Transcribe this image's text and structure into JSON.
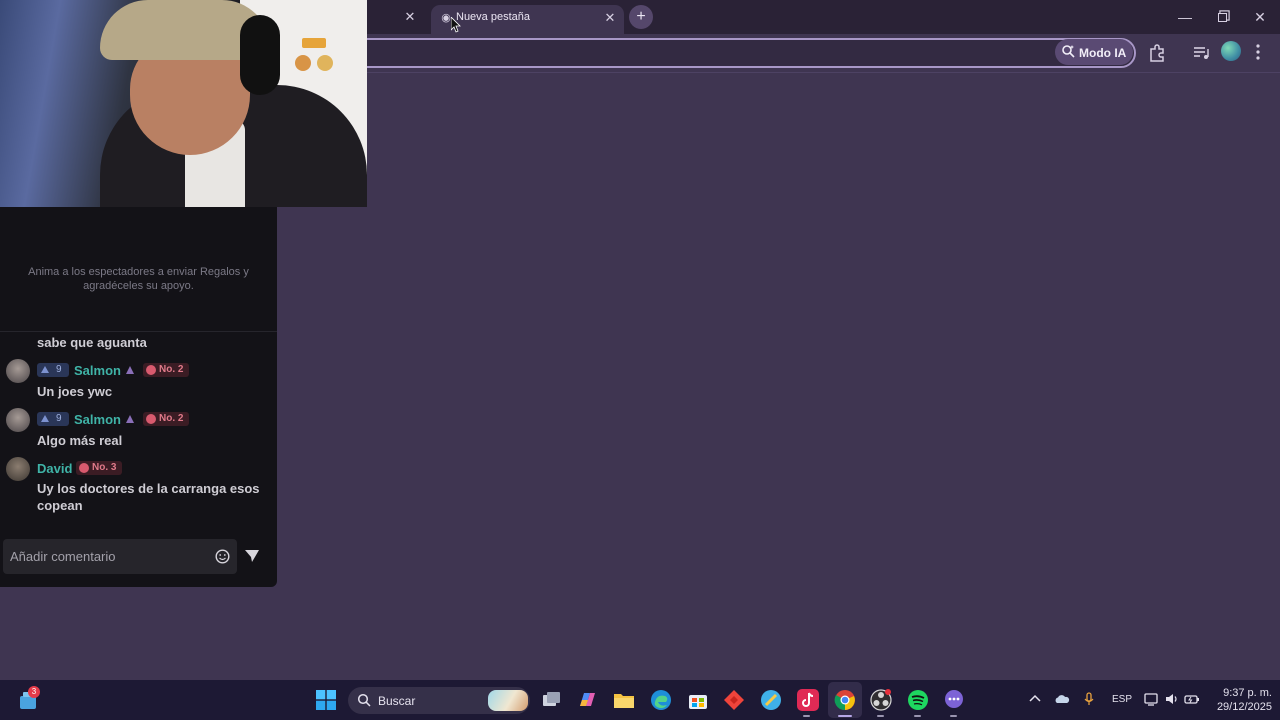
{
  "browser": {
    "active_tab_title": "Nueva pestaña",
    "ai_mode_label": "Modo IA"
  },
  "chat": {
    "gift_prompt": "Anima a los espectadores a enviar Regalos y agradéceles su apoyo.",
    "partial_message": "sabe que aguanta",
    "messages": [
      {
        "level": "9",
        "user": "Salmon",
        "rank": "No. 2",
        "text": "Un joes ywc"
      },
      {
        "level": "9",
        "user": "Salmon",
        "rank": "No. 2",
        "text": "Algo más real"
      },
      {
        "user": "David",
        "rank": "No. 3",
        "text": "Uy los doctores de la carranga esos copean"
      }
    ],
    "comment_placeholder": "Añadir comentario"
  },
  "taskbar": {
    "widget_badge": "3",
    "search_label": "Buscar",
    "language": "ESP",
    "time": "9:37 p. m.",
    "date": "29/12/2025"
  },
  "colors": {
    "page_bg": "#3f3551",
    "tabstrip_bg": "#2a2236",
    "chat_bg": "#131217",
    "username": "#3fb3a7",
    "rank_badge": "#e07a8a",
    "taskbar_bg": "#1d1934"
  }
}
